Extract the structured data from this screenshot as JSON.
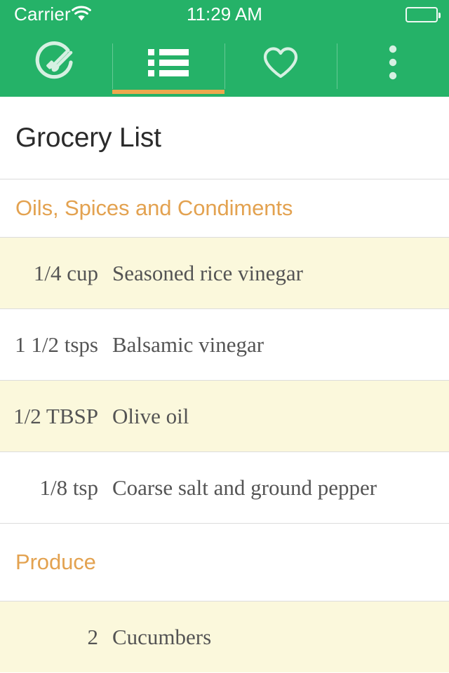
{
  "status_bar": {
    "carrier": "Carrier",
    "time": "11:29 AM",
    "wifi_icon": "wifi-icon",
    "battery_icon": "battery-full-icon"
  },
  "theme": {
    "header_green": "#25b268",
    "accent_orange": "#eda84e",
    "section_orange": "#e3a250",
    "row_highlight": "#fbf8dc",
    "text_dark": "#2b2b2b",
    "row_text": "#545454",
    "divider": "#dcdcdc"
  },
  "tabs": [
    {
      "name": "recipes",
      "icon": "cooking-utensils-icon",
      "label": "Recipes",
      "active": false
    },
    {
      "name": "grocery-list",
      "icon": "list-icon",
      "label": "Grocery List",
      "active": true
    },
    {
      "name": "favorites",
      "icon": "heart-icon",
      "label": "Favorites",
      "active": false
    },
    {
      "name": "more",
      "icon": "overflow-menu-icon",
      "label": "More",
      "active": false
    }
  ],
  "page": {
    "title": "Grocery List"
  },
  "sections": [
    {
      "title": "Oils, Spices and Condiments",
      "items": [
        {
          "qty": "1/4 cup",
          "name": "Seasoned rice vinegar"
        },
        {
          "qty": "1 1/2 tsps",
          "name": "Balsamic vinegar"
        },
        {
          "qty": "1/2 TBSP",
          "name": "Olive oil"
        },
        {
          "qty": "1/8 tsp",
          "name": "Coarse salt and ground pepper"
        }
      ]
    },
    {
      "title": "Produce",
      "items": [
        {
          "qty": "2",
          "name": "Cucumbers"
        }
      ]
    }
  ]
}
